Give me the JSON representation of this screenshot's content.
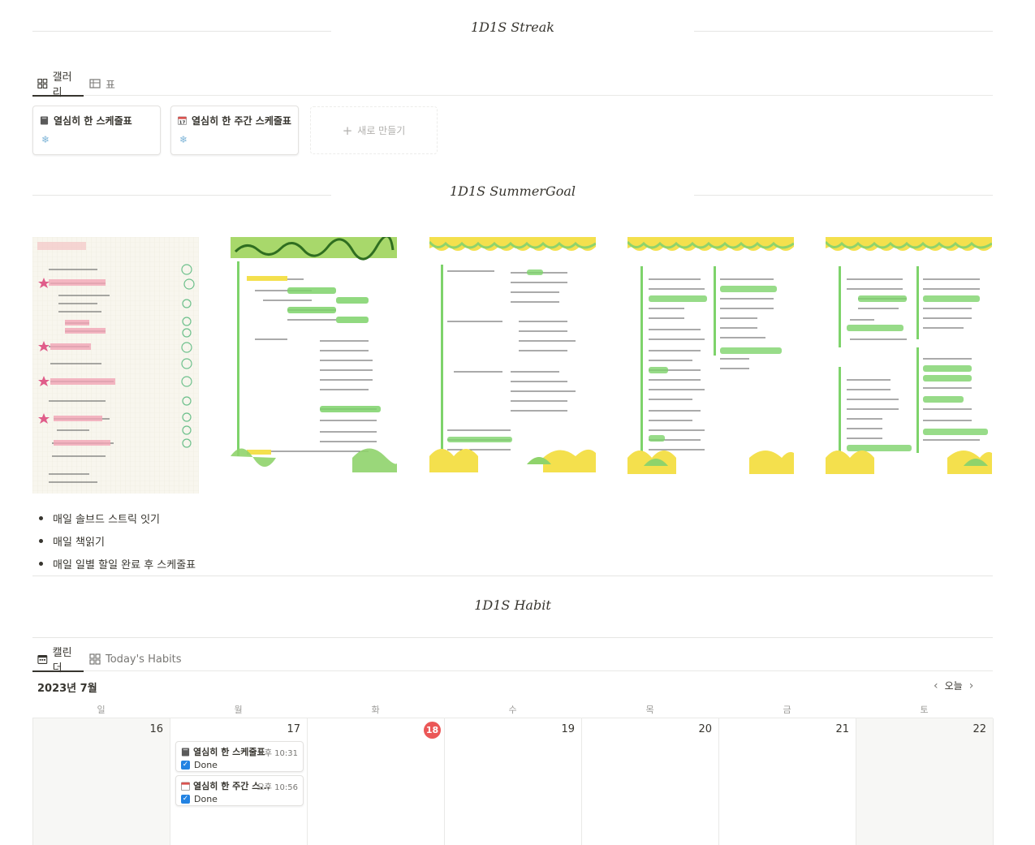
{
  "sections": {
    "streak_title": "1D1S  Streak",
    "summergoal_title": "1D1S  SummerGoal",
    "habit_title": "1D1S  Habit"
  },
  "streak_tabs": [
    {
      "label": "갤러리",
      "icon": "gallery-icon",
      "active": true
    },
    {
      "label": "표",
      "icon": "table-icon",
      "active": false
    }
  ],
  "cards": [
    {
      "title": "열심히 한 스케줄표",
      "icon": "notebook-icon",
      "sub": "❄"
    },
    {
      "title": "열심히 한 주간 스케줄표",
      "icon": "calendar-icon",
      "calendar_day": "17",
      "sub": "❄"
    }
  ],
  "new_card_label": "새로 만들기",
  "goals": [
    "매일 솔브드 스트릭 잇기",
    "매일 책읽기",
    "매일 일별 할일 완료 후 스케줄표"
  ],
  "habit_tabs": [
    {
      "label": "캘린더",
      "icon": "calendar-view-icon",
      "active": true
    },
    {
      "label": "Today's Habits",
      "icon": "gallery-icon",
      "active": false
    }
  ],
  "calendar": {
    "month_label": "2023년 7월",
    "today_label": "오늘",
    "weekdays": [
      "일",
      "월",
      "화",
      "수",
      "목",
      "금",
      "토"
    ],
    "days": [
      "16",
      "17",
      "18",
      "19",
      "20",
      "21",
      "22"
    ],
    "today_index": 2,
    "events": [
      {
        "title": "열심히 한 스케줄표",
        "time": "오후 10:31",
        "status": "Done",
        "icon": "notebook-icon"
      },
      {
        "title": "열심히 한 주간 스...",
        "time": "오후 10:56",
        "status": "Done",
        "icon": "calendar-icon"
      }
    ]
  },
  "colors": {
    "accent_blue": "#2383e2",
    "today_red": "#eb5757",
    "planner_green": "#7ed36b",
    "planner_yellow": "#f4e04d"
  }
}
